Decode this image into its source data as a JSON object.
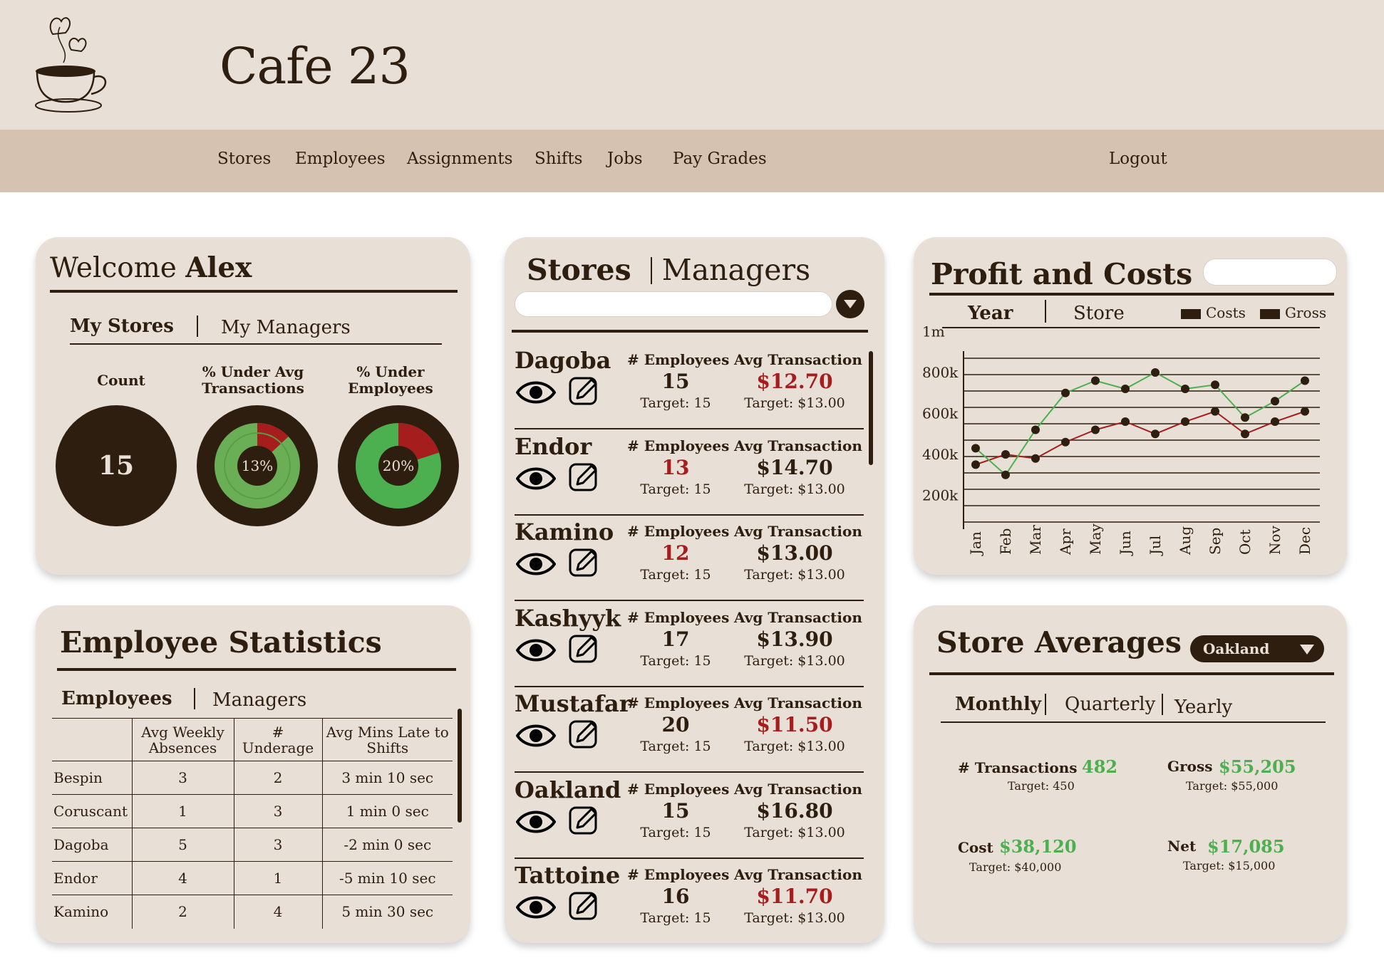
{
  "app": {
    "title": "Cafe 23"
  },
  "nav": {
    "items": [
      "Stores",
      "Employees",
      "Assignments",
      "Shifts",
      "Jobs",
      "Pay Grades"
    ],
    "logout": "Logout"
  },
  "welcome": {
    "prefix": "Welcome",
    "name": "Alex",
    "tabs": [
      "My Stores",
      "My Managers"
    ],
    "metrics": [
      {
        "label_lines": [
          "Count"
        ],
        "value": "15"
      },
      {
        "label_lines": [
          "% Under Avg",
          "Transactions"
        ],
        "value": "13%",
        "percent": 13
      },
      {
        "label_lines": [
          "% Under",
          "Employees"
        ],
        "value": "20%",
        "percent": 20
      }
    ]
  },
  "employee_stats": {
    "title": "Employee Statistics",
    "tabs": [
      "Employees",
      "Managers"
    ],
    "headers": [
      "",
      "Avg Weekly Absences",
      "# Underage",
      "Avg Mins Late to Shifts"
    ],
    "rows": [
      [
        "Bespin",
        "3",
        "2",
        "3 min 10 sec"
      ],
      [
        "Coruscant",
        "1",
        "3",
        "1 min 0 sec"
      ],
      [
        "Dagoba",
        "5",
        "3",
        "-2 min 0 sec"
      ],
      [
        "Endor",
        "4",
        "1",
        "-5 min 10 sec"
      ],
      [
        "Kamino",
        "2",
        "4",
        "5 min 30 sec"
      ]
    ]
  },
  "stores": {
    "title_active": "Stores",
    "title_inactive": "Managers",
    "search_placeholder": "",
    "col_employees": "# Employees",
    "col_avg": "Avg Transaction",
    "rows": [
      {
        "name": "Dagoba",
        "employees": "15",
        "emp_target": "Target: 15",
        "avg": "$12.70",
        "avg_target": "Target: $13.00",
        "emp_red": false,
        "avg_red": true
      },
      {
        "name": "Endor",
        "employees": "13",
        "emp_target": "Target: 15",
        "avg": "$14.70",
        "avg_target": "Target: $13.00",
        "emp_red": true,
        "avg_red": false
      },
      {
        "name": "Kamino",
        "employees": "12",
        "emp_target": "Target: 15",
        "avg": "$13.00",
        "avg_target": "Target: $13.00",
        "emp_red": true,
        "avg_red": false
      },
      {
        "name": "Kashyyk",
        "employees": "17",
        "emp_target": "Target: 15",
        "avg": "$13.90",
        "avg_target": "Target: $13.00",
        "emp_red": false,
        "avg_red": false
      },
      {
        "name": "Mustafar",
        "employees": "20",
        "emp_target": "Target: 15",
        "avg": "$11.50",
        "avg_target": "Target: $13.00",
        "emp_red": false,
        "avg_red": true
      },
      {
        "name": "Oakland",
        "employees": "15",
        "emp_target": "Target: 15",
        "avg": "$16.80",
        "avg_target": "Target: $13.00",
        "emp_red": false,
        "avg_red": false
      },
      {
        "name": "Tattoine",
        "employees": "16",
        "emp_target": "Target: 15",
        "avg": "$11.70",
        "avg_target": "Target: $13.00",
        "emp_red": false,
        "avg_red": true
      }
    ]
  },
  "profit": {
    "title": "Profit and Costs",
    "tabs": [
      "Year",
      "Store"
    ],
    "legend": [
      "Costs",
      "Gross"
    ]
  },
  "chart_data": {
    "type": "line",
    "categories": [
      "Jan",
      "Feb",
      "Mar",
      "Apr",
      "May",
      "Jun",
      "Jul",
      "Aug",
      "Sep",
      "Oct",
      "Nov",
      "Dec"
    ],
    "y_ticks": [
      "1m",
      "800k",
      "600k",
      "400k",
      "200k"
    ],
    "ylim": [
      0,
      1000000
    ],
    "grid": true,
    "series": [
      {
        "name": "Costs",
        "color": "#a61d1d",
        "values": [
          350000,
          400000,
          380000,
          460000,
          520000,
          560000,
          500000,
          560000,
          610000,
          500000,
          560000,
          610000
        ]
      },
      {
        "name": "Gross",
        "color": "#4caf50",
        "values": [
          430000,
          300000,
          520000,
          700000,
          760000,
          720000,
          800000,
          720000,
          740000,
          580000,
          660000,
          760000
        ]
      }
    ]
  },
  "averages": {
    "title": "Store Averages",
    "selected_store": "Oakland",
    "tabs": [
      "Monthly",
      "Quarterly",
      "Yearly"
    ],
    "stats": [
      {
        "label": "# Transactions",
        "value": "482",
        "target": "Target: 450"
      },
      {
        "label": "Gross",
        "value": "$55,205",
        "target": "Target: $55,000"
      },
      {
        "label": "Cost",
        "value": "$38,120",
        "target": "Target: $40,000"
      },
      {
        "label": "Net",
        "value": "$17,085",
        "target": "Target: $15,000"
      }
    ]
  },
  "colors": {
    "dark": "#2e1e0f",
    "card": "#e8e0d6",
    "nav": "#d6c2b0",
    "green": "#4caf50",
    "red": "#a61d1d",
    "light_green": "#6aaf55"
  }
}
